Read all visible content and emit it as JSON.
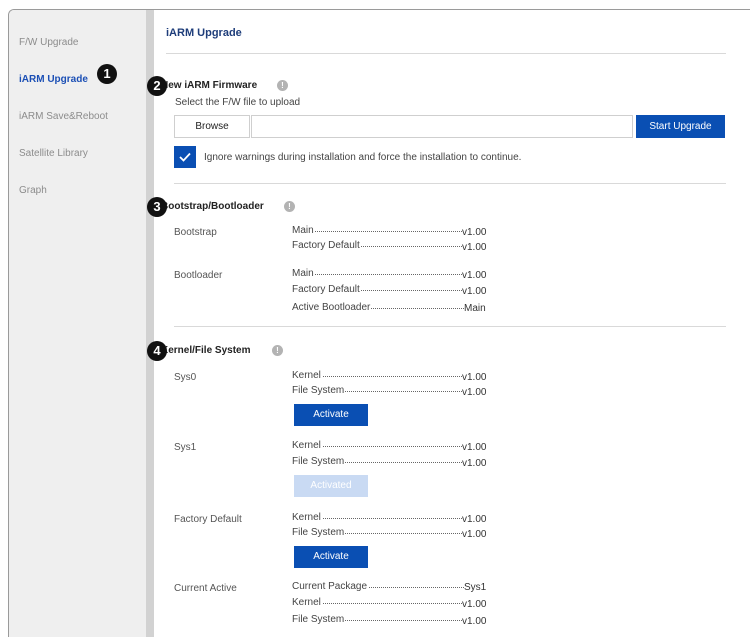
{
  "sidebar": {
    "items": [
      {
        "label": "F/W Upgrade"
      },
      {
        "label": "iARM Upgrade"
      },
      {
        "label": "iARM Save&Reboot"
      },
      {
        "label": "Satellite Library"
      },
      {
        "label": "Graph"
      }
    ],
    "active_index": 1
  },
  "markers": [
    "1",
    "2",
    "3",
    "4"
  ],
  "page": {
    "title": "iARM Upgrade"
  },
  "firmware": {
    "title": "New iARM Firmware",
    "instruction": "Select the F/W file to upload",
    "browse_label": "Browse",
    "file_value": "",
    "upgrade_label": "Start Upgrade",
    "force_checked": true,
    "force_label": "Ignore warnings during installation and force the installation to continue."
  },
  "bootstrap": {
    "title": "Bootstrap/Bootloader",
    "bootstrap_label": "Bootstrap",
    "bootstrap_main_key": "Main",
    "bootstrap_main_val": "v1.00",
    "bootstrap_factory_key": "Factory Default",
    "bootstrap_factory_val": "v1.00",
    "bootloader_label": "Bootloader",
    "bootloader_main_key": "Main",
    "bootloader_main_val": "v1.00",
    "bootloader_factory_key": "Factory Default",
    "bootloader_factory_val": "v1.00",
    "bootloader_active_key": "Active Bootloader",
    "bootloader_active_val": "Main"
  },
  "kernel": {
    "title": "Kernel/File System",
    "sys0_label": "Sys0",
    "sys0_kernel_key": "Kernel",
    "sys0_kernel_val": "v1.00",
    "sys0_fs_key": "File System",
    "sys0_fs_val": "v1.00",
    "sys0_button": "Activate",
    "sys1_label": "Sys1",
    "sys1_kernel_key": "Kernel",
    "sys1_kernel_val": "v1.00",
    "sys1_fs_key": "File System",
    "sys1_fs_val": "v1.00",
    "sys1_button": "Activated",
    "factory_label": "Factory Default",
    "factory_kernel_key": "Kernel",
    "factory_kernel_val": "v1.00",
    "factory_fs_key": "File System",
    "factory_fs_val": "v1.00",
    "factory_button": "Activate",
    "current_label": "Current Active",
    "current_pkg_key": "Current Package",
    "current_pkg_val": "Sys1",
    "current_kernel_key": "Kernel",
    "current_kernel_val": "v1.00",
    "current_fs_key": "File System",
    "current_fs_val": "v1.00"
  },
  "colors": {
    "accent": "#0a4fb3",
    "active_nav": "#1b4fb5",
    "title": "#1e3d7a",
    "disabled_button": "#c9daf3"
  },
  "icons": [
    "info-icon",
    "checkmark-icon"
  ]
}
